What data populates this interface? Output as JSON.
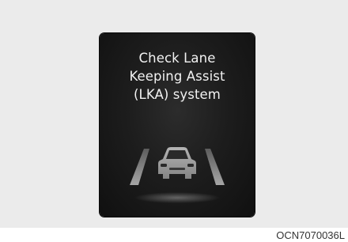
{
  "display": {
    "message_lines": [
      "Check Lane",
      "Keeping Assist",
      "(LKA) system"
    ],
    "icon": "lane-keeping-assist-icon"
  },
  "caption": "OCN7070036L",
  "colors": {
    "background": "#ebebeb",
    "screen": "#1b1b1b",
    "text": "#f2f2f2",
    "icon": "#8c8c8c"
  }
}
